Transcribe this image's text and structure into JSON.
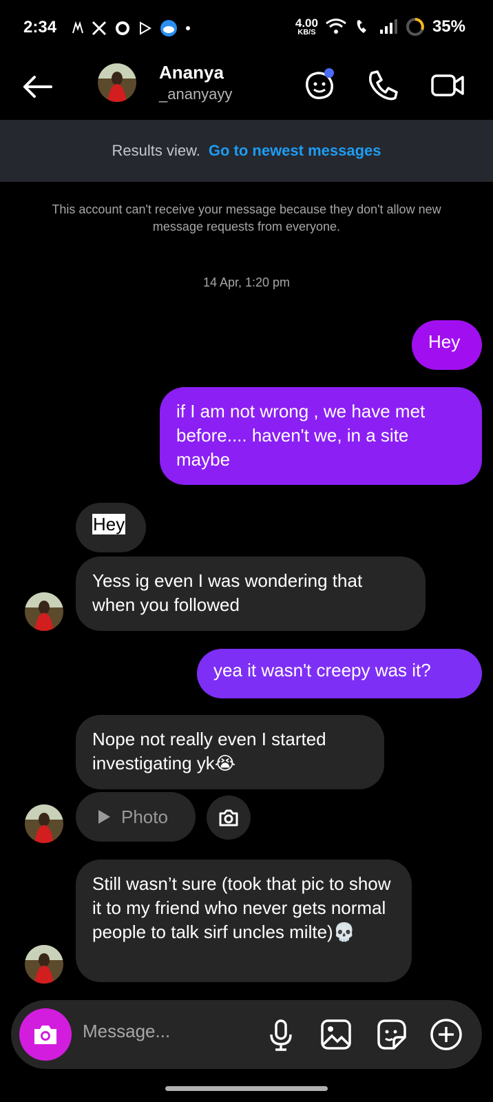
{
  "status_bar": {
    "time": "2:34",
    "net_speed_value": "4.00",
    "net_speed_unit": "KB/S",
    "battery": "35%",
    "icons": [
      "m-notification-icon",
      "x-app-icon",
      "whatsapp-icon",
      "play-icon",
      "weather-cloud-icon",
      "dot-icon",
      "wifi-icon",
      "wifi-call-icon",
      "signal-icon",
      "battery-ring-icon"
    ]
  },
  "header": {
    "name": "Ananya",
    "username": "_ananyayy"
  },
  "banner": {
    "muted_text": "Results view.",
    "link_text": "Go to newest messages"
  },
  "notice": "This account can't receive your message because they don't allow new message requests from everyone.",
  "timestamp": "14 Apr, 1:20 pm",
  "messages": [
    {
      "side": "out",
      "text": "Hey"
    },
    {
      "side": "out",
      "text": "if I am not wrong , we have met before.... haven't we, in a  site maybe"
    },
    {
      "side": "in",
      "text": "Hey"
    },
    {
      "side": "in",
      "text": "Yess ig even I was wondering that when you followed"
    },
    {
      "side": "out",
      "text": "yea it wasn't creepy was it?"
    },
    {
      "side": "in",
      "text": "Nope not really even I started investigating yk😭"
    },
    {
      "side": "in",
      "text": "Photo"
    },
    {
      "side": "in",
      "text": "Still wasn’t sure (took that pic to show it to my friend who never gets normal people to talk sirf uncles milte)💀"
    }
  ],
  "composer": {
    "placeholder": "Message..."
  },
  "colors": {
    "accent_link": "#1e9cf3",
    "outgoing_bubble": "#a10ff0",
    "incoming_bubble": "#262626",
    "camera_button": "#d31dde"
  }
}
